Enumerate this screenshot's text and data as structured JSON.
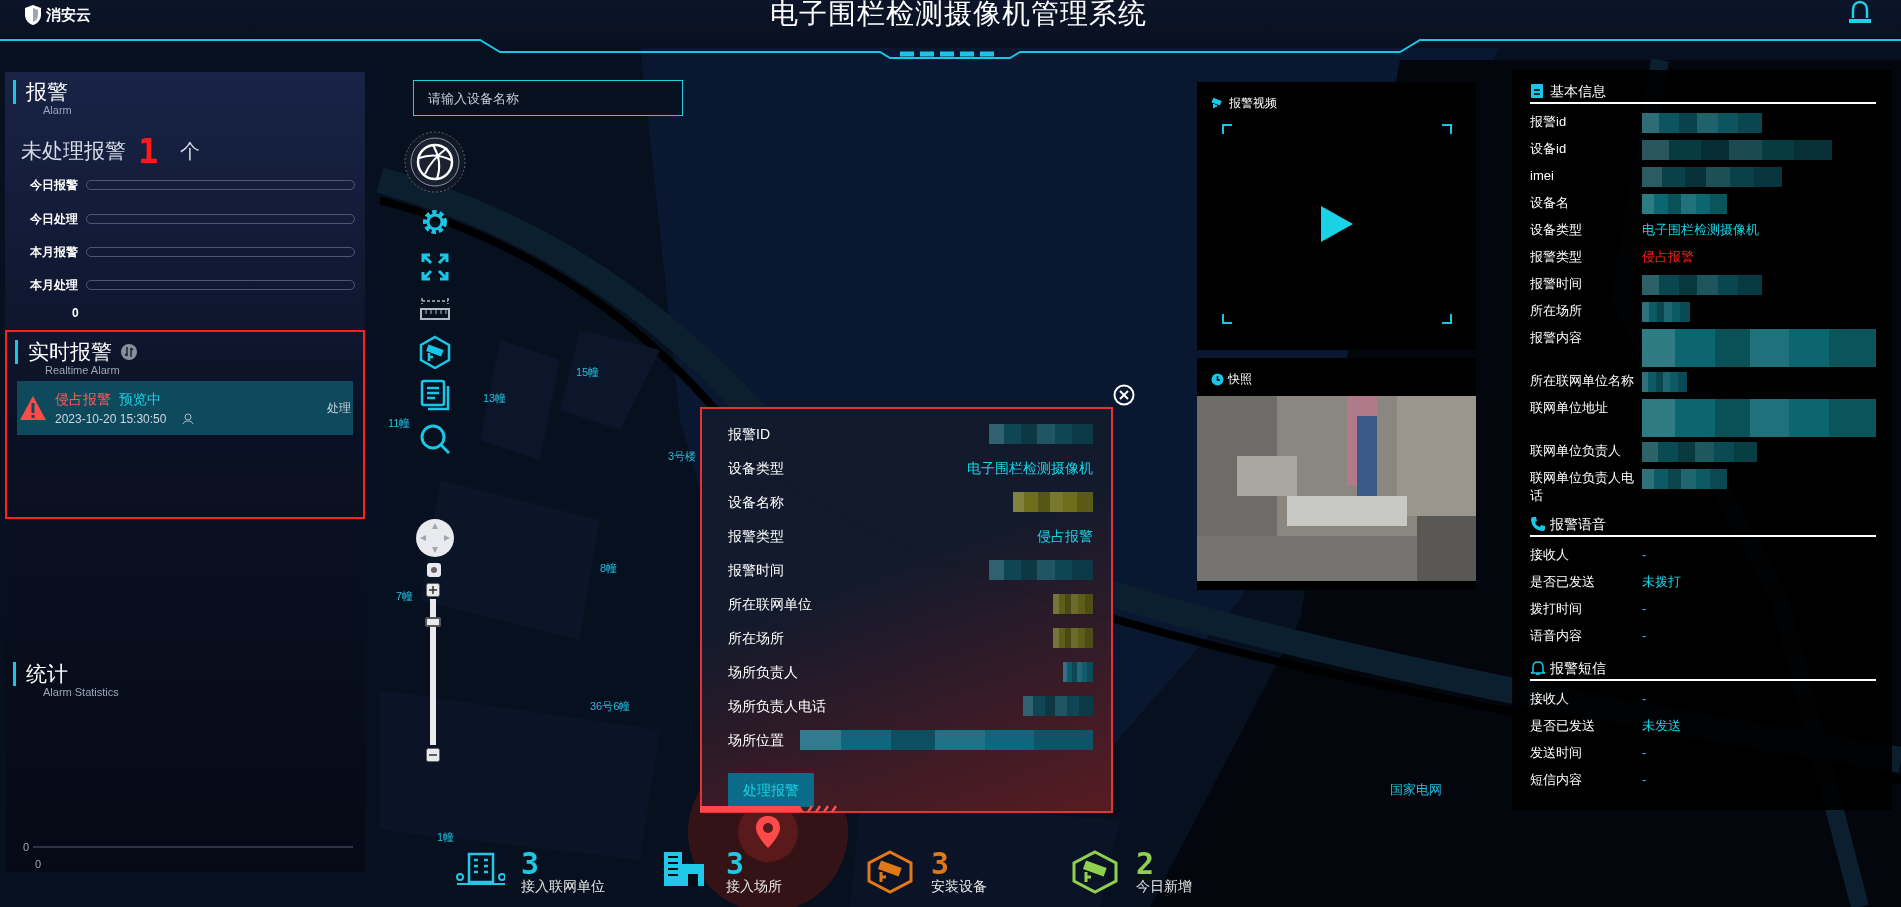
{
  "header": {
    "logo": "消安云",
    "title": "电子围栏检测摄像机管理系统"
  },
  "alarm_panel": {
    "title": "报警",
    "subtitle": "Alarm",
    "unhandled_label": "未处理报警",
    "unhandled_count": "1",
    "unit": "个",
    "axis_value": "0",
    "bars": [
      {
        "label": "今日报警"
      },
      {
        "label": "今日处理"
      },
      {
        "label": "本月报警"
      },
      {
        "label": "本月处理"
      }
    ]
  },
  "realtime_panel": {
    "title": "实时报警",
    "subtitle": "Realtime Alarm",
    "highlighted": true,
    "alarms": [
      {
        "type": "侵占报警",
        "status": "预览中",
        "time": "2023-10-20 15:30:50",
        "action": "处理"
      }
    ]
  },
  "stats_panel": {
    "title": "统计",
    "subtitle": "Alarm Statistics",
    "y_tick": "0",
    "x_tick": "0"
  },
  "search": {
    "placeholder": "请输入设备名称"
  },
  "map_labels": [
    {
      "text": "15幢"
    },
    {
      "text": "13幢"
    },
    {
      "text": "11幢"
    },
    {
      "text": "3号楼"
    },
    {
      "text": "8幢"
    },
    {
      "text": "7幢"
    },
    {
      "text": "36号6幢"
    },
    {
      "text": "1幢"
    },
    {
      "text": "国家电网"
    }
  ],
  "zoom": {
    "level": 0.87
  },
  "popup": {
    "button": "处理报警",
    "rows": [
      {
        "label": "报警ID",
        "kind": "blur",
        "color": "#0f4656"
      },
      {
        "label": "设备类型",
        "kind": "text",
        "value": "电子围栏检测摄像机"
      },
      {
        "label": "设备名称",
        "kind": "blur",
        "color": "#6e6e1c"
      },
      {
        "label": "报警类型",
        "kind": "text",
        "value": "侵占报警"
      },
      {
        "label": "报警时间",
        "kind": "blur",
        "color": "#0f4656"
      },
      {
        "label": "所在联网单位",
        "kind": "blur",
        "color": "#5e5e1a"
      },
      {
        "label": "所在场所",
        "kind": "blur",
        "color": "#5e5e1a"
      },
      {
        "label": "场所负责人",
        "kind": "blur",
        "color": "#115a6c"
      },
      {
        "label": "场所负责人电话",
        "kind": "blur",
        "color": "#0f4656"
      },
      {
        "label": "场所位置",
        "kind": "blur",
        "color": "#11657c"
      }
    ]
  },
  "video": {
    "title": "报警视频"
  },
  "snapshot": {
    "title": "快照",
    "kind": "picture"
  },
  "info": {
    "sections": [
      {
        "title": "基本信息",
        "rows": [
          {
            "label": "报警id",
            "kind": "blur",
            "color": "#0c5560"
          },
          {
            "label": "设备id",
            "kind": "blur",
            "color": "#083a42"
          },
          {
            "label": "imei",
            "kind": "blur",
            "color": "#0a4048"
          },
          {
            "label": "设备名",
            "kind": "blur",
            "color": "#0c6670"
          },
          {
            "label": "设备类型",
            "kind": "text",
            "value": "电子围栏检测摄像机"
          },
          {
            "label": "报警类型",
            "kind": "alert",
            "value": "侵占报警"
          },
          {
            "label": "报警时间",
            "kind": "blur",
            "color": "#0a4650"
          },
          {
            "label": "所在场所",
            "kind": "blur",
            "color": "#0c5a64"
          },
          {
            "label": "报警内容",
            "kind": "blur",
            "color": "#0c6670"
          },
          {
            "label": "所在联网单位名称",
            "kind": "blur",
            "color": "#0c5a64"
          },
          {
            "label": "联网单位地址",
            "kind": "blur",
            "color": "#0c6670"
          },
          {
            "label": "联网单位负责人",
            "kind": "blur",
            "color": "#0a4a52"
          },
          {
            "label": "联网单位负责人电话",
            "kind": "blur",
            "color": "#0c5a64"
          }
        ]
      },
      {
        "title": "报警语音",
        "rows": [
          {
            "label": "接收人",
            "kind": "text",
            "value": "-"
          },
          {
            "label": "是否已发送",
            "kind": "text",
            "value": "未拨打"
          },
          {
            "label": "拨打时间",
            "kind": "text",
            "value": "-"
          },
          {
            "label": "语音内容",
            "kind": "text",
            "value": "-"
          }
        ]
      },
      {
        "title": "报警短信",
        "rows": [
          {
            "label": "接收人",
            "kind": "text",
            "value": "-"
          },
          {
            "label": "是否已发送",
            "kind": "text",
            "value": "未发送"
          },
          {
            "label": "发送时间",
            "kind": "text",
            "value": "-"
          },
          {
            "label": "短信内容",
            "kind": "text",
            "value": "-"
          }
        ]
      }
    ]
  },
  "summary": [
    {
      "number": "3",
      "label": "接入联网单位",
      "color": "#1ec8e6"
    },
    {
      "number": "3",
      "label": "接入场所",
      "color": "#1ec8e6"
    },
    {
      "number": "3",
      "label": "安装设备",
      "color": "#e07818"
    },
    {
      "number": "2",
      "label": "今日新增",
      "color": "#8fd14f"
    }
  ]
}
